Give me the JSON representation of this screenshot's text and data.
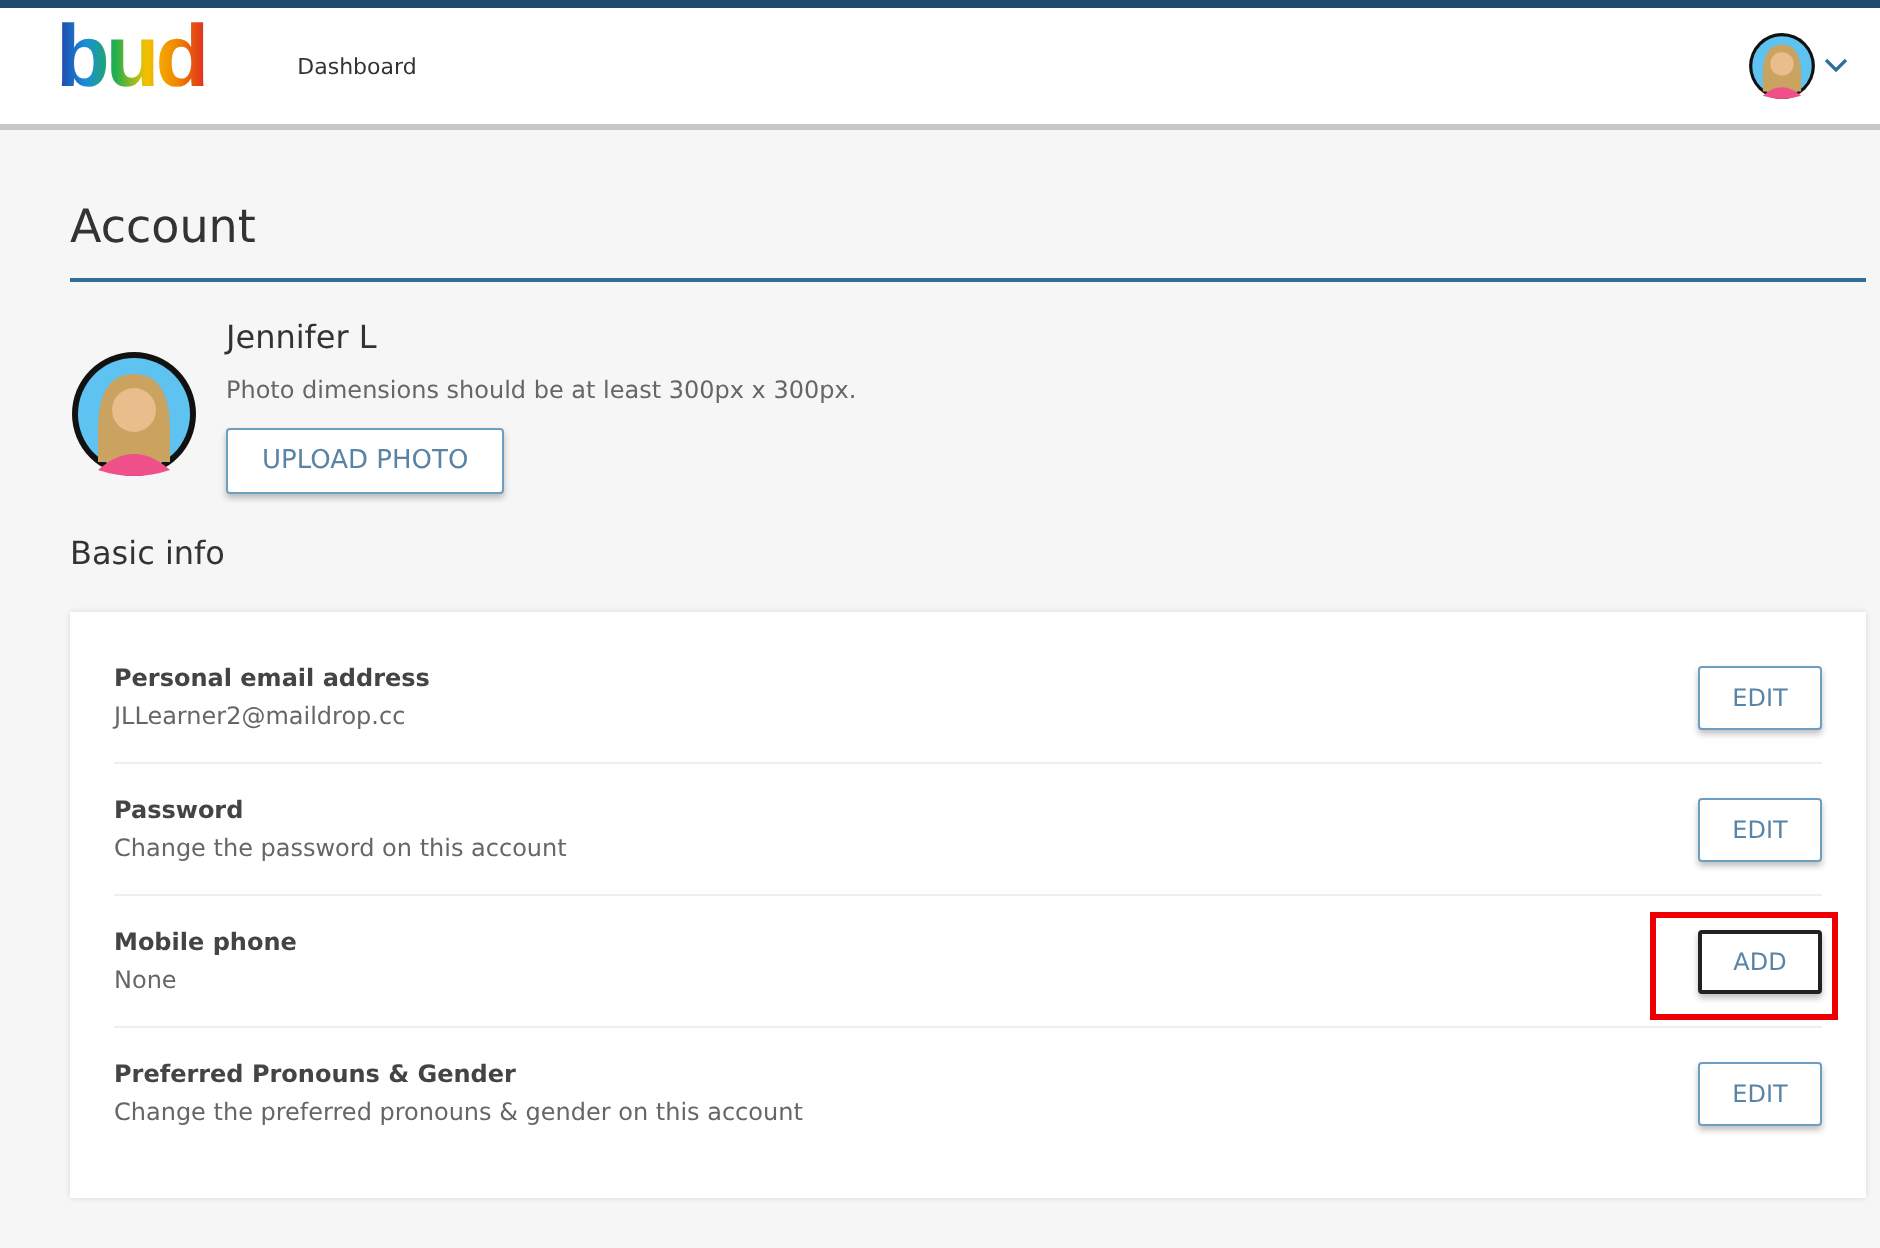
{
  "header": {
    "logo": "bud",
    "nav": [
      {
        "label": "Dashboard"
      }
    ]
  },
  "page": {
    "title": "Account"
  },
  "profile": {
    "name": "Jennifer L",
    "hint": "Photo dimensions should be at least 300px x 300px.",
    "upload_button": "UPLOAD PHOTO"
  },
  "basic_info": {
    "title": "Basic info",
    "rows": [
      {
        "label": "Personal email address",
        "value": "JLLearner2@maildrop.cc",
        "button": "EDIT",
        "highlighted": false
      },
      {
        "label": "Password",
        "value": "Change the password on this account",
        "button": "EDIT",
        "highlighted": false
      },
      {
        "label": "Mobile phone",
        "value": "None",
        "button": "ADD",
        "highlighted": true
      },
      {
        "label": "Preferred Pronouns & Gender",
        "value": "Change the preferred pronouns & gender on this account",
        "button": "EDIT",
        "highlighted": false
      }
    ]
  }
}
